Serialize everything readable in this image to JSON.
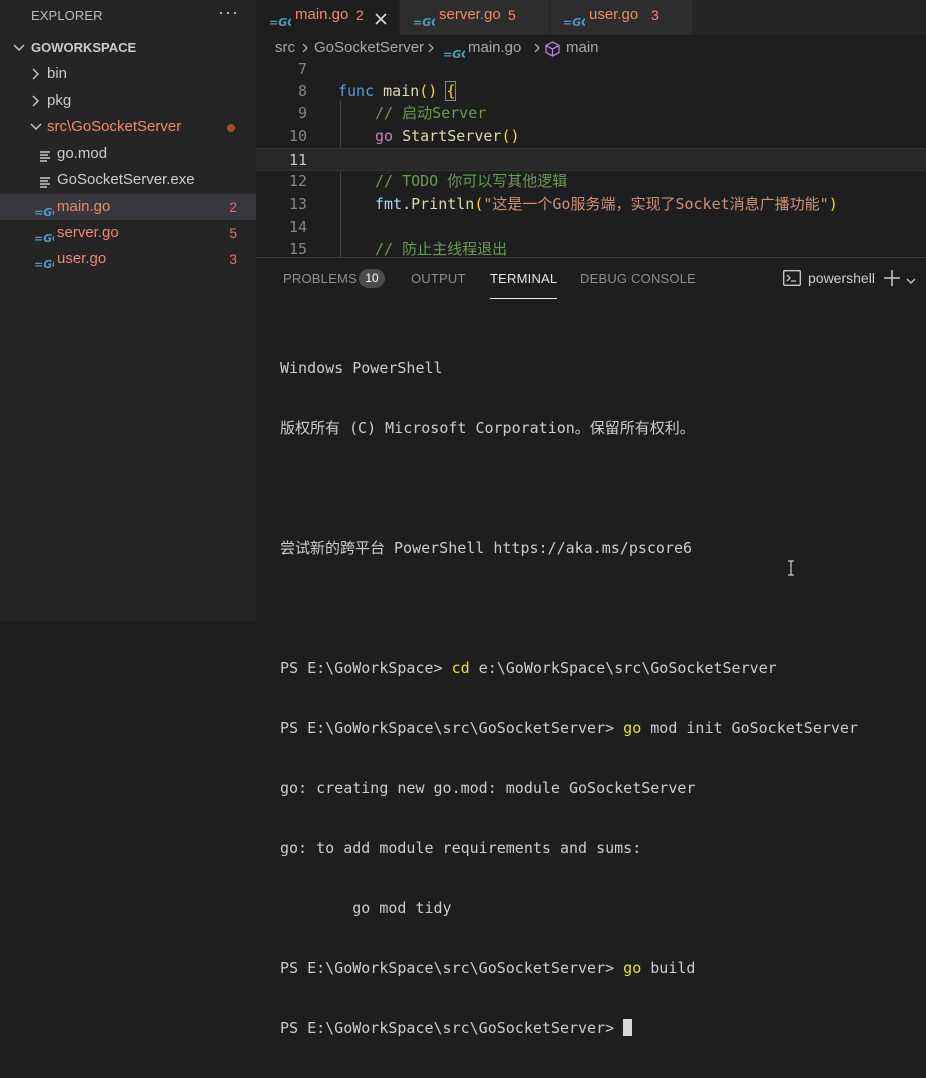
{
  "explorer": {
    "title": "EXPLORER",
    "more_icon": "ellipsis-icon",
    "workspace": "GOWORKSPACE",
    "items": [
      {
        "label": "bin",
        "type": "folder"
      },
      {
        "label": "pkg",
        "type": "folder"
      },
      {
        "label": "src\\GoSocketServer",
        "type": "folder-open"
      },
      {
        "label": "go.mod",
        "type": "file"
      },
      {
        "label": "GoSocketServer.exe",
        "type": "file"
      },
      {
        "label": "main.go",
        "type": "go",
        "badge": "2"
      },
      {
        "label": "server.go",
        "type": "go",
        "badge": "5"
      },
      {
        "label": "user.go",
        "type": "go",
        "badge": "3"
      }
    ]
  },
  "tabs": [
    {
      "label": "main.go",
      "count": "2",
      "active": true
    },
    {
      "label": "server.go",
      "count": "5"
    },
    {
      "label": "user.go",
      "count": "3"
    }
  ],
  "breadcrumb": {
    "seg1": "src",
    "seg2": "GoSocketServer",
    "seg3": "main.go",
    "seg4": "main"
  },
  "editor": {
    "line_numbers": [
      "7",
      "8",
      "9",
      "10",
      "11",
      "12",
      "13",
      "14",
      "15"
    ],
    "lines": {
      "l8_kw": "func",
      "l8_fn": "main",
      "l8_paren": "()",
      "l8_brace": "{",
      "l9": "// 启动Server",
      "l10_kw": "go",
      "l10_fn": "StartServer",
      "l10_paren": "()",
      "l12": "// TODO 你可以写其他逻辑",
      "l13_pkg": "fmt",
      "l13_dot": ".",
      "l13_fn": "Println",
      "l13_open": "(",
      "l13_str": "\"这是一个Go服务端，实现了Socket消息广播功能\"",
      "l13_close": ")",
      "l15": "// 防止主线程退出"
    }
  },
  "panel": {
    "tabs": {
      "problems": "PROBLEMS",
      "problems_count": "10",
      "output": "OUTPUT",
      "terminal": "TERMINAL",
      "debug": "DEBUG CONSOLE"
    },
    "shell": "powershell",
    "terminal_lines": {
      "t1": "Windows PowerShell",
      "t2": "版权所有 (C) Microsoft Corporation。保留所有权利。",
      "t4": "尝试新的跨平台 PowerShell https://aka.ms/pscore6",
      "t6_prompt": "PS E:\\GoWorkSpace> ",
      "t6_cmd": "cd",
      "t6_args": " e:\\GoWorkSpace\\src\\GoSocketServer",
      "t7_prompt": "PS E:\\GoWorkSpace\\src\\GoSocketServer> ",
      "t7_cmd": "go",
      "t7_args": " mod init GoSocketServer",
      "t8": "go: creating new go.mod: module GoSocketServer",
      "t9": "go: to add module requirements and sums:",
      "t10": "        go mod tidy",
      "t11_prompt": "PS E:\\GoWorkSpace\\src\\GoSocketServer> ",
      "t11_cmd": "go",
      "t11_args": " build",
      "t12_prompt": "PS E:\\GoWorkSpace\\src\\GoSocketServer> "
    }
  },
  "colors": {
    "error": "#f48771",
    "go_blue": "#519aba",
    "accent": "#007acc"
  }
}
